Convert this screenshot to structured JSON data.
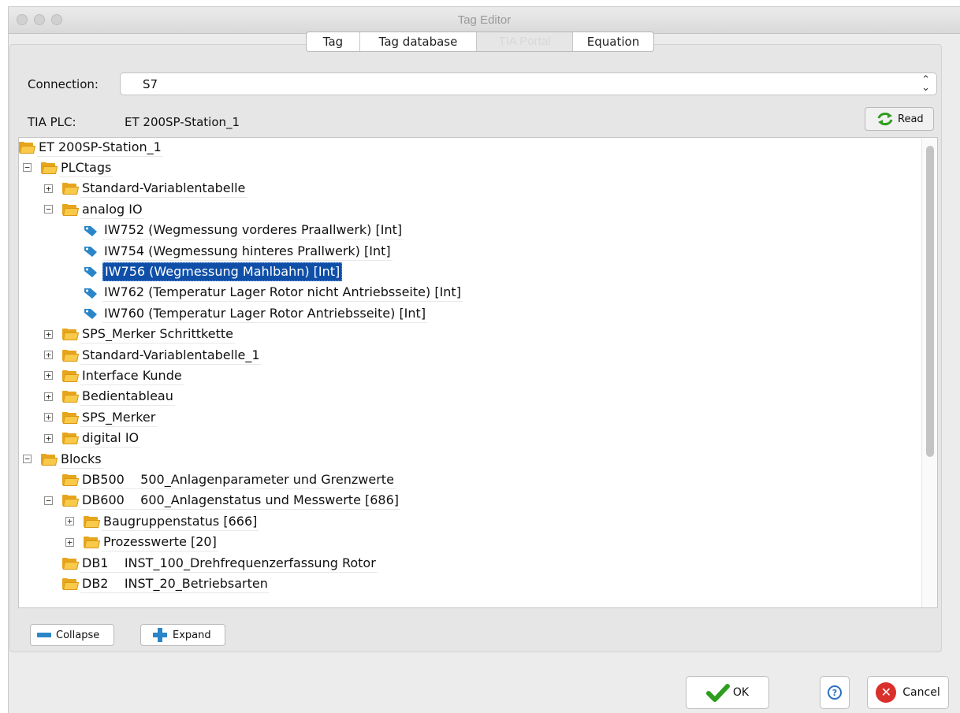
{
  "window": {
    "title": "Tag Editor"
  },
  "tabs": [
    {
      "label": "Tag",
      "active": false
    },
    {
      "label": "Tag database",
      "active": false
    },
    {
      "label": "TIA Portal",
      "active": true
    },
    {
      "label": "Equation",
      "active": false
    }
  ],
  "connection": {
    "label": "Connection:",
    "value": "S7"
  },
  "tia_plc": {
    "label": "TIA PLC:",
    "value": "ET 200SP-Station_1"
  },
  "read_button": {
    "label": "Read",
    "icon": "refresh-icon"
  },
  "tree": {
    "nodes": [
      {
        "text": "ET 200SP-Station_1",
        "type": "folder",
        "toggle": "",
        "depth": 0
      },
      {
        "text": "PLCtags",
        "type": "folder",
        "toggle": "−",
        "depth": 1
      },
      {
        "text": "Standard-Variablentabelle",
        "type": "folder",
        "toggle": "+",
        "depth": 2
      },
      {
        "text": "analog IO",
        "type": "folder",
        "toggle": "−",
        "depth": 2
      },
      {
        "text": "IW752 (Wegmessung vorderes Praallwerk) [Int]",
        "type": "tag",
        "toggle": "",
        "depth": 3
      },
      {
        "text": "IW754 (Wegmessung hinteres Prallwerk) [Int]",
        "type": "tag",
        "toggle": "",
        "depth": 3
      },
      {
        "text": "IW756 (Wegmessung Mahlbahn) [Int]",
        "type": "tag",
        "toggle": "",
        "depth": 3,
        "selected": true
      },
      {
        "text": "IW762 (Temperatur Lager Rotor nicht Antriebsseite) [Int]",
        "type": "tag",
        "toggle": "",
        "depth": 3
      },
      {
        "text": "IW760 (Temperatur Lager Rotor Antriebsseite) [Int]",
        "type": "tag",
        "toggle": "",
        "depth": 3
      },
      {
        "text": "SPS_Merker Schrittkette",
        "type": "folder",
        "toggle": "+",
        "depth": 2
      },
      {
        "text": "Standard-Variablentabelle_1",
        "type": "folder",
        "toggle": "+",
        "depth": 2
      },
      {
        "text": "Interface Kunde",
        "type": "folder",
        "toggle": "+",
        "depth": 2
      },
      {
        "text": "Bedientableau",
        "type": "folder",
        "toggle": "+",
        "depth": 2
      },
      {
        "text": "SPS_Merker",
        "type": "folder",
        "toggle": "+",
        "depth": 2
      },
      {
        "text": "digital IO",
        "type": "folder",
        "toggle": "+",
        "depth": 2
      },
      {
        "text": "Blocks",
        "type": "folder",
        "toggle": "−",
        "depth": 1
      },
      {
        "text": "DB500    500_Anlagenparameter und Grenzwerte",
        "type": "folder",
        "toggle": "",
        "depth": 2
      },
      {
        "text": "DB600    600_Anlagenstatus und Messwerte [686]",
        "type": "folder",
        "toggle": "−",
        "depth": 2
      },
      {
        "text": "Baugruppenstatus [666]",
        "type": "folder",
        "toggle": "+",
        "depth": 3
      },
      {
        "text": "Prozesswerte [20]",
        "type": "folder",
        "toggle": "+",
        "depth": 3
      },
      {
        "text": "DB1    INST_100_Drehfrequenzerfassung Rotor",
        "type": "folder",
        "toggle": "",
        "depth": 2
      },
      {
        "text": "DB2    INST_20_Betriebsarten",
        "type": "folder",
        "toggle": "",
        "depth": 2
      }
    ]
  },
  "collapse_button": {
    "label": "Collapse",
    "icon": "minus-icon"
  },
  "expand_button": {
    "label": "Expand",
    "icon": "plus-icon"
  },
  "ok_button": {
    "label": "OK",
    "icon": "checkmark-icon"
  },
  "help_button": {
    "label": "?",
    "icon": "help-icon"
  },
  "cancel_button": {
    "label": "Cancel",
    "icon": "cancel-icon"
  },
  "colors": {
    "selection": "#0f4fa8",
    "folder": "#f9c94a",
    "tag": "#2a86c9",
    "ok_check": "#2e9d1f",
    "cancel_red": "#d9302b"
  }
}
